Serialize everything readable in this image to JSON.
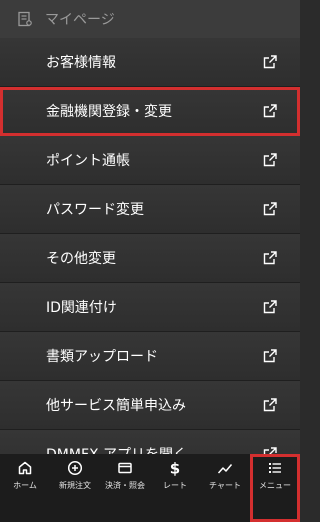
{
  "header": {
    "title": "マイページ",
    "icon": "document-icon"
  },
  "menu": {
    "items": [
      {
        "label": "お客様情報",
        "icon": "external-link-icon"
      },
      {
        "label": "金融機関登録・変更",
        "icon": "external-link-icon",
        "highlighted": true
      },
      {
        "label": "ポイント通帳",
        "icon": "external-link-icon"
      },
      {
        "label": "パスワード変更",
        "icon": "external-link-icon"
      },
      {
        "label": "その他変更",
        "icon": "external-link-icon"
      },
      {
        "label": "ID関連付け",
        "icon": "external-link-icon"
      },
      {
        "label": "書類アップロード",
        "icon": "external-link-icon"
      },
      {
        "label": "他サービス簡単申込み",
        "icon": "external-link-icon"
      },
      {
        "label": "DMMFX アプリを開く",
        "icon": "external-link-icon"
      }
    ]
  },
  "bottom_nav": {
    "items": [
      {
        "label": "ホーム",
        "icon": "home-icon"
      },
      {
        "label": "新規注文",
        "icon": "plus-circle-icon"
      },
      {
        "label": "決済・照会",
        "icon": "card-icon"
      },
      {
        "label": "レート",
        "icon": "dollar-icon"
      },
      {
        "label": "チャート",
        "icon": "chart-line-icon"
      },
      {
        "label": "メニュー",
        "icon": "menu-list-icon",
        "active": true
      }
    ]
  },
  "colors": {
    "highlight": "#d32f2f",
    "background": "#2b2b2b",
    "header": "#3c3c3c",
    "nav": "#1c1c1c"
  }
}
